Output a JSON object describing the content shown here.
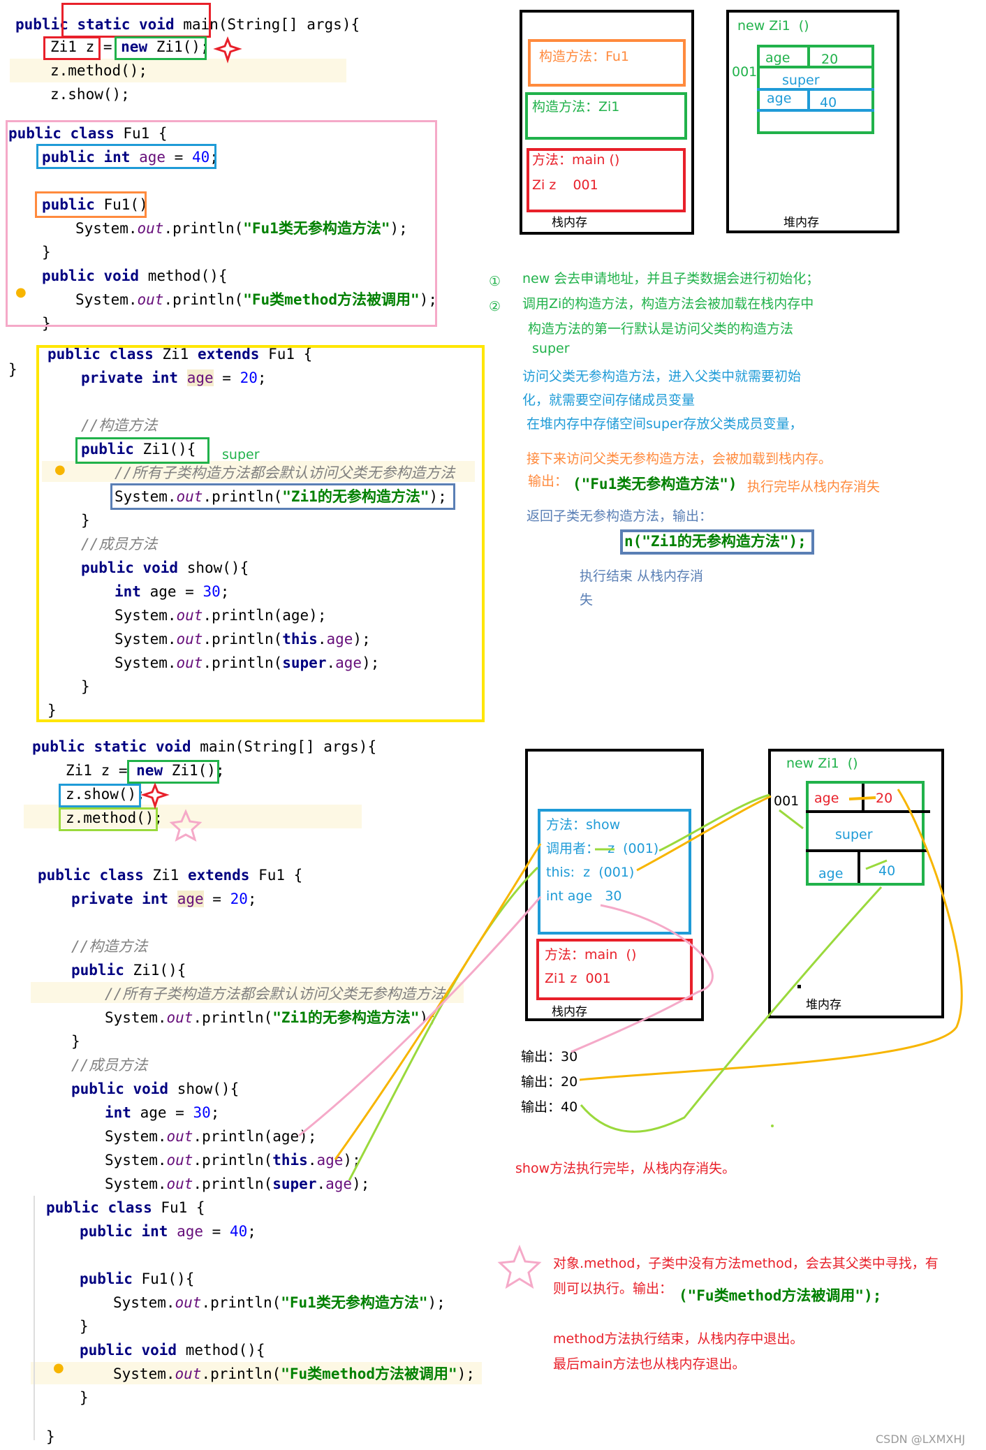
{
  "top_code": {
    "main_sig": [
      "public",
      " static ",
      "void ",
      "main",
      "(String[] args){"
    ],
    "line1": [
      "Zi1 z",
      " = ",
      "new",
      " Zi1();"
    ],
    "line2": "z.method();",
    "line3": "z.show();"
  },
  "fu1_top": {
    "l1": [
      "public class",
      " Fu1 {"
    ],
    "l2": [
      "public int ",
      "age",
      " = ",
      "40",
      ";"
    ],
    "l3": [
      "public",
      " Fu1()"
    ],
    "l4": [
      "System.",
      "out",
      ".println(",
      "\"Fu1类无参构造方法\"",
      ");"
    ],
    "l5": "}",
    "l6": [
      "public void",
      " method(){"
    ],
    "l7": [
      "System.",
      "out",
      ".println(",
      "\"Fu类method方法被调用\"",
      ");"
    ],
    "l8": "}",
    "l9": "}"
  },
  "zi1_top": {
    "l1": [
      "public class",
      " Zi1 ",
      "extends",
      " Fu1 {"
    ],
    "l2": [
      "private int ",
      "age",
      " = ",
      "20",
      ";"
    ],
    "l3": "//构造方法",
    "l4": [
      "public",
      " Zi1(){"
    ],
    "super_note": "super",
    "l5": "//所有子类构造方法都会默认访问父类无参构造方法",
    "l6": [
      "System.",
      "out",
      ".println(",
      "\"Zi1的无参构造方法\"",
      ");"
    ],
    "l7": "}",
    "l8": "//成员方法",
    "l9": [
      "public void",
      " show(){"
    ],
    "l10": [
      "int",
      " age = ",
      "30",
      ";"
    ],
    "l11": [
      "System.",
      "out",
      ".println(age);"
    ],
    "l12": [
      "System.",
      "out",
      ".println(",
      "this",
      ".",
      "age",
      ");"
    ],
    "l13": [
      "System.",
      "out",
      ".println(",
      "super",
      ".",
      "age",
      ");"
    ],
    "l14": "}",
    "l15": "}"
  },
  "diagram_top": {
    "stack": {
      "ctor_fu1": "构造方法：Fu1",
      "ctor_zi1": "构造方法：Zi1",
      "main": "方法：main ()",
      "var": "Zi z    001",
      "label": "栈内存"
    },
    "heap": {
      "title": "new Zi1  ()",
      "addr": "001",
      "age1": "age",
      "val1": "20",
      "super": "super",
      "age2": "age",
      "val2": "40",
      "label": "堆内存"
    }
  },
  "notes_top": {
    "n1_marker": "①",
    "n1": "new 会去申请地址，并且子类数据会进行初始化；",
    "n2_marker": "②",
    "n2": "调用Zi的构造方法，构造方法会被加载在栈内存中",
    "n3": "构造方法的第一行默认是访问父类的构造方法",
    "n4": "super",
    "n5": "访问父类无参构造方法，进入父类中就需要初始",
    "n6": "化，就需要空间存储成员变量",
    "n7": "在堆内存中存储空间super存放父类成员变量，",
    "n8": "接下来访问父类无参构造方法，会被加载到栈内存。",
    "n9_label": "输出：",
    "n9_code": "(\"Fu1类无参构造方法\")",
    "n9_tail": "执行完毕从栈内存消失",
    "n10": "返回子类无参构造方法，输出：",
    "n11_code": "n(\"Zi1的无参构造方法\");",
    "n12": "执行结束 从栈内存消",
    "n13": "失"
  },
  "bottom_code": {
    "main_sig": [
      "public static void",
      " main(String[] args){"
    ],
    "line1": [
      "Zi1 z = ",
      "new",
      " Zi1();"
    ],
    "line2": "z.show();",
    "line3": "z.method();"
  },
  "zi1_bottom": {
    "l1": [
      "public class",
      " Zi1 ",
      "extends",
      " Fu1 {"
    ],
    "l2": [
      "private int ",
      "age",
      " = ",
      "20",
      ";"
    ],
    "l3": "//构造方法",
    "l4": [
      "public",
      " Zi1(){"
    ],
    "l5": "//所有子类构造方法都会默认访问父类无参构造方法",
    "l6": [
      "System.",
      "out",
      ".println(",
      "\"Zi1的无参构造方法\"",
      ");"
    ],
    "l7": "}",
    "l8": "//成员方法",
    "l9": [
      "public void",
      " show(){"
    ],
    "l10": [
      "int",
      " age = ",
      "30",
      ";"
    ],
    "l11": [
      "System.",
      "out",
      ".println(age);"
    ],
    "l12": [
      "System.",
      "out",
      ".println(",
      "this",
      ".",
      "age",
      ");"
    ],
    "l13": [
      "System.",
      "out",
      ".println(",
      "super",
      ".",
      "age",
      ");"
    ]
  },
  "fu1_bottom": {
    "l1": [
      "public class",
      " Fu1 {"
    ],
    "l2": [
      "public int ",
      "age",
      " = ",
      "40",
      ";"
    ],
    "l3": [
      "public",
      " Fu1(){"
    ],
    "l4": [
      "System.",
      "out",
      ".println(",
      "\"Fu1类无参构造方法\"",
      ");"
    ],
    "l5": "}",
    "l6": [
      "public void",
      " method(){"
    ],
    "l7": [
      "System.",
      "out",
      ".println(",
      "\"Fu类method方法被调用\"",
      ");"
    ],
    "l8": "}",
    "l9": "}"
  },
  "diagram_bottom": {
    "stack": {
      "show": "方法：show",
      "caller": "调用者：  z  (001)",
      "this": "this:  z  (001)",
      "int_age": "int age   30",
      "main": "方法：main  ()",
      "var": "Zi1 z  001",
      "label": "栈内存"
    },
    "heap": {
      "title": "new Zi1  ()",
      "addr": "001",
      "age1": "age",
      "val1": "20",
      "super": "super",
      "age2": "age",
      "val2": "40",
      "label": "堆内存"
    },
    "outputs": [
      "输出：30",
      "输出：20",
      "输出：40"
    ]
  },
  "notes_bottom": {
    "show_done": "show方法执行完毕，从栈内存消失。",
    "method_l1": "对象.method，子类中没有方法method，会去其父类中寻找，有",
    "method_l2": "则可以执行。输出：",
    "method_code": "(\"Fu类method方法被调用\");",
    "end_l1": "method方法执行结束，从栈内存中退出。",
    "end_l2": "最后main方法也从栈内存退出。"
  },
  "watermark": "CSDN @LXMXHJ",
  "colors": {
    "red": "#e8202a",
    "green": "#21b24b",
    "blue": "#1f9bd7",
    "orange": "#ff8a3d",
    "yellow": "#ffe600",
    "pink": "#f5a9c8",
    "lightgreen": "#9ad93c",
    "gold": "#f7b500",
    "slate": "#5a7fb5"
  }
}
